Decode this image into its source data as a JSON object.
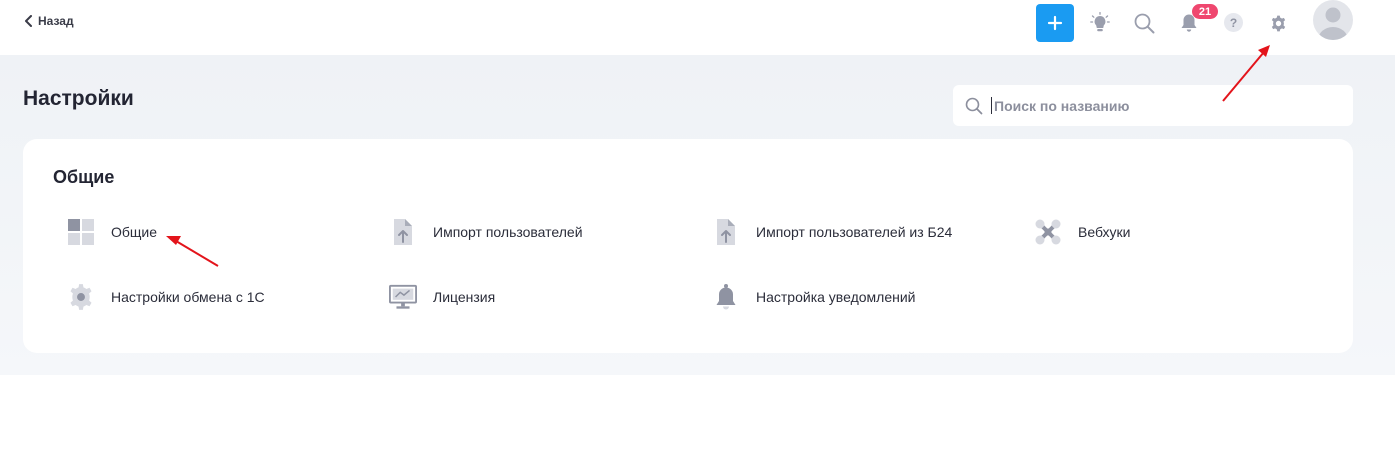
{
  "topbar": {
    "back_label": "Назад",
    "add_label": "+",
    "notification_count": "21",
    "help_label": "?",
    "accent_color": "#1a9bf2",
    "badge_color": "#ef476f"
  },
  "page": {
    "title": "Настройки",
    "search_placeholder": "Поиск по названию"
  },
  "section": {
    "title": "Общие",
    "items": [
      {
        "label": "Общие",
        "icon": "grid-icon"
      },
      {
        "label": "Импорт пользователей",
        "icon": "file-upload-icon"
      },
      {
        "label": "Импорт пользователей из Б24",
        "icon": "file-upload-icon"
      },
      {
        "label": "Вебхуки",
        "icon": "webhook-icon"
      },
      {
        "label": "Настройки обмена с 1С",
        "icon": "gear-icon"
      },
      {
        "label": "Лицензия",
        "icon": "monitor-icon"
      },
      {
        "label": "Настройка уведомлений",
        "icon": "bell-icon"
      }
    ]
  },
  "annotation_color": "#e3141b"
}
